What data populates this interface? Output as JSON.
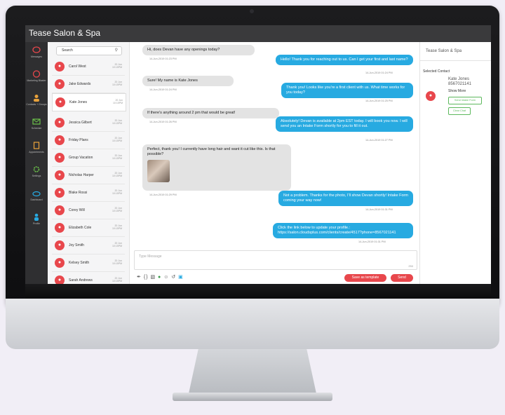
{
  "app": {
    "title": "Tease Salon & Spa"
  },
  "rail": {
    "items": [
      {
        "label": "Messages",
        "icon": "chat-bubble-icon"
      },
      {
        "label": "Marketing Blaster",
        "icon": "megaphone-icon"
      },
      {
        "label": "Contacts + Groups",
        "icon": "people-icon"
      },
      {
        "label": "Schedule",
        "icon": "envelope-icon"
      },
      {
        "label": "Appointments",
        "icon": "document-icon"
      },
      {
        "label": "Settings",
        "icon": "gear-icon"
      },
      {
        "label": "Dashboard",
        "icon": "cloud-icon"
      },
      {
        "label": "Profile",
        "icon": "person-icon"
      }
    ]
  },
  "contacts": {
    "search_placeholder": "Search",
    "items": [
      {
        "name": "Carol West",
        "time": "20 Jun 10:15PM"
      },
      {
        "name": "Jake Edwards",
        "time": "20 Jun 10:15PM"
      },
      {
        "name": "Kate Jones",
        "time": "20 Jun 10:15PM"
      },
      {
        "name": "Jessica Gilbert",
        "time": "20 Jun 10:15PM"
      },
      {
        "name": "Friday Plans",
        "time": "20 Jun 10:15PM"
      },
      {
        "name": "Group Vacation",
        "time": "20 Jun 10:15PM"
      },
      {
        "name": "Nicholas Harper",
        "time": "20 Jun 10:15PM"
      },
      {
        "name": "Blake Rossi",
        "time": "20 Jun 10:15PM"
      },
      {
        "name": "Corey Will",
        "time": "20 Jun 10:15PM"
      },
      {
        "name": "Elizabeth Cole",
        "time": "20 Jun 10:15PM"
      },
      {
        "name": "Joy Smith",
        "time": "20 Jun 10:15PM"
      },
      {
        "name": "Kelsey Smith",
        "time": "20 Jun 10:15PM"
      },
      {
        "name": "Sarah Andrews",
        "time": "20 Jun 10:15PM"
      }
    ]
  },
  "chat": {
    "messages": [
      {
        "dir": "in",
        "text": "Hi, does Devan have any openings today?",
        "time": "14-Jun-2019 01:23 PM"
      },
      {
        "dir": "out",
        "text": "Hello! Thank you for reaching out to us. Can I get your first and last name?",
        "time": "14-Jun-2019 01:24 PM"
      },
      {
        "dir": "in",
        "text": "Sure! My name is Kate Jones",
        "time": "14-Jun-2019 01:24 PM"
      },
      {
        "dir": "out",
        "text": "Thank you! Looks like you're a first client with us. What time works for you today?",
        "time": "14-Jun-2019 01:25 PM"
      },
      {
        "dir": "in",
        "text": "If there's anything around 2 pm that would be great!",
        "time": "14-Jun-2019 01:26 PM"
      },
      {
        "dir": "out",
        "text": "Absolutely! Devan is available at 2pm EST today. I will book you now. I will send you an Intake Form shortly for you to fill it out.",
        "time": "14-Jun-2019 01:27 PM"
      },
      {
        "dir": "in",
        "text": "Perfect, thank you! I currently have long hair and want it cut like this. Is that possible?",
        "time": "14-Jun-2019 01:29 PM"
      },
      {
        "dir": "out",
        "text": "Not a problem. Thanks for the photo, I'll show Devan shortly! Intake Form coming your way now!",
        "time": "14-Jun-2019 01:31 PM"
      },
      {
        "dir": "out",
        "text": "Click the link below to update your profile.: https://salon.cloudsplus.com/clients/create/4517?phone=8567021141",
        "time": "14-Jun-2019 01:31 PM"
      }
    ],
    "compose_placeholder": "Type Message",
    "char_count": "250",
    "save_template_label": "Save as template",
    "send_label": "Send"
  },
  "panel": {
    "title": "Tease Salon & Spa",
    "selected_label": "Selected Contact",
    "contact_name": "Kate Jones",
    "contact_phone": "8567021141",
    "show_more": "Show More",
    "intake_button": "Send Intake Form",
    "clear_button": "Clear Chat"
  },
  "colors": {
    "accent_red": "#e8474c",
    "bubble_blue": "#27aae1",
    "bubble_gray": "#e3e3e3",
    "titlebar": "#3a3a3c"
  }
}
